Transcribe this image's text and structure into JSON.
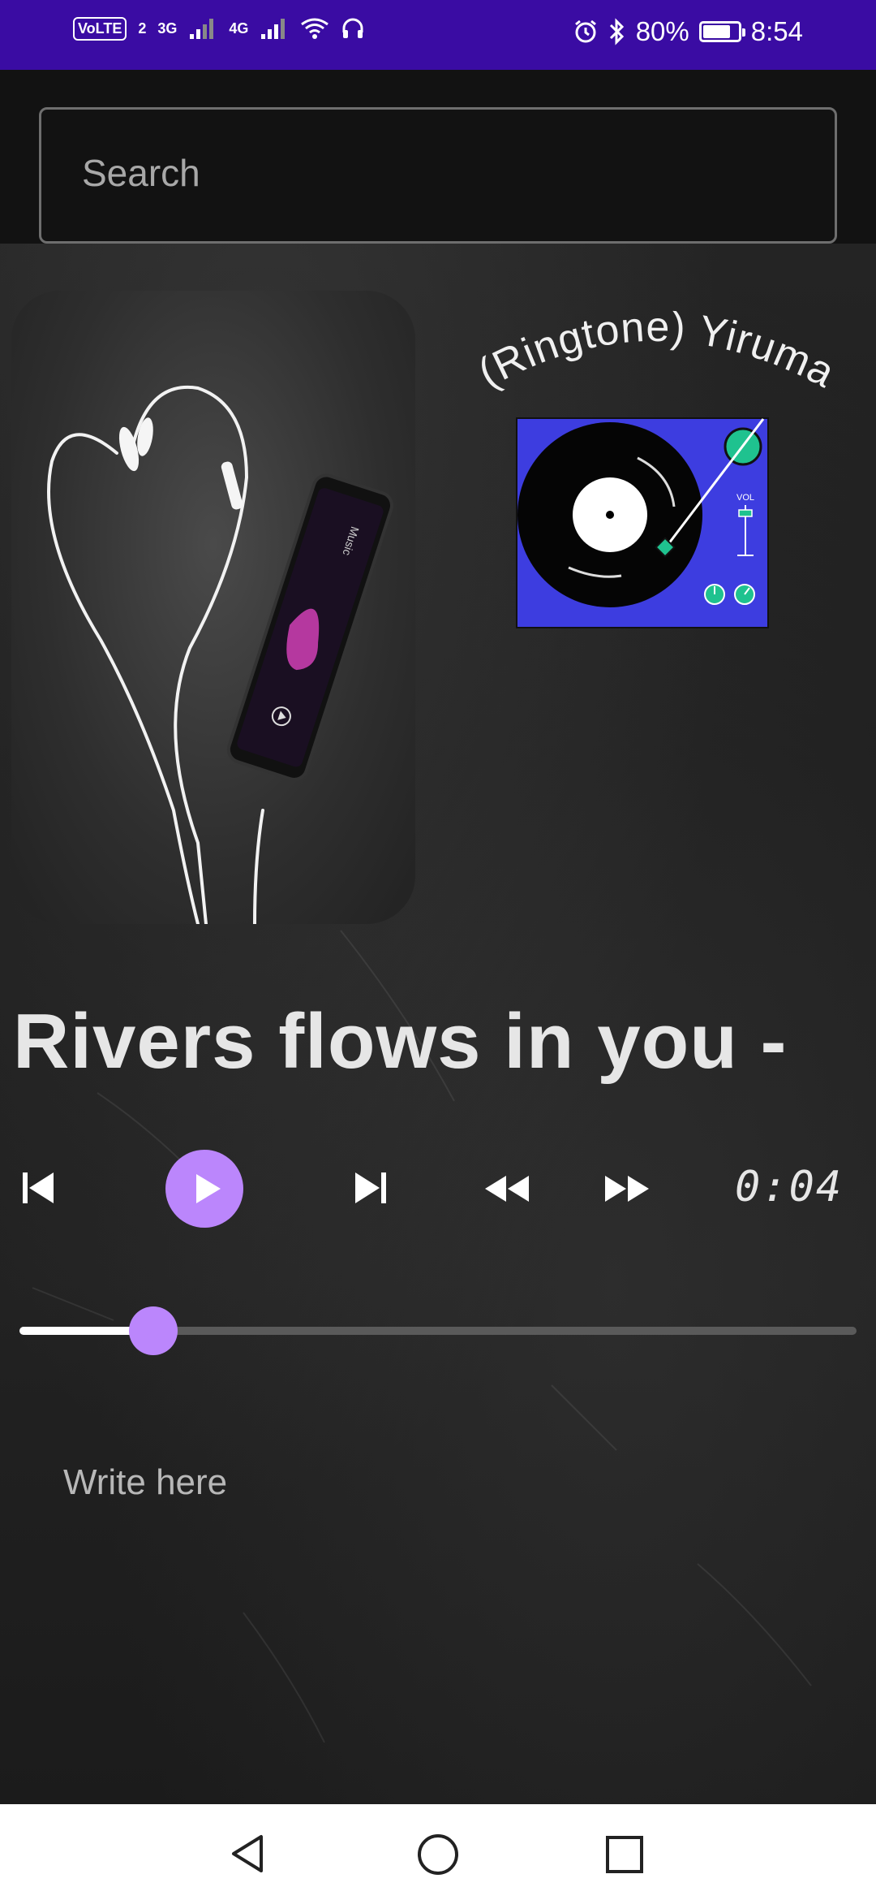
{
  "status_bar": {
    "volte_label": "VoLTE",
    "sim_label": "2",
    "net1_label": "3G",
    "net2_label": "4G",
    "battery_text": "80%",
    "battery_level": 0.8,
    "time": "8:54"
  },
  "search": {
    "placeholder": "Search"
  },
  "album": {
    "ringtone_title": "(Ringtone) Yiruma",
    "turntable_vol_label": "VOL",
    "phone_app_label": "Music"
  },
  "song": {
    "title": "Rivers flows in you -"
  },
  "player": {
    "elapsed": "0:04",
    "progress": 0.16
  },
  "notes": {
    "placeholder": "Write here"
  },
  "colors": {
    "status_bar_bg": "#3a0ca3",
    "accent": "#bb86fc",
    "turntable_bg": "#3d3de0",
    "turntable_knob": "#1fc28f"
  }
}
